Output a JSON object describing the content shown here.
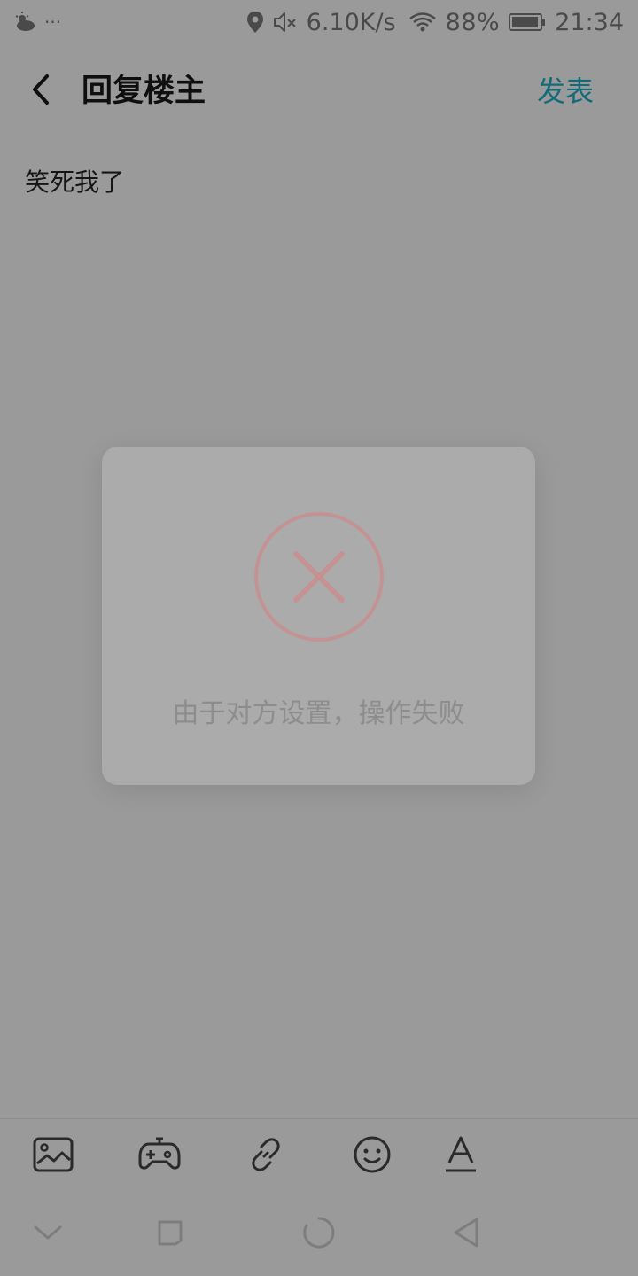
{
  "status_bar": {
    "overflow_dots": "···",
    "network_speed": "6.10K/s",
    "battery_percent": "88%",
    "time": "21:34",
    "icons": [
      "weather-icon",
      "location-icon",
      "mute-icon",
      "wifi-icon",
      "battery-icon"
    ]
  },
  "header": {
    "back_icon": "chevron-left-icon",
    "title": "回复楼主",
    "publish_label": "发表"
  },
  "editor": {
    "content": "笑死我了"
  },
  "toast": {
    "icon": "error-x-icon",
    "message": "由于对方设置，操作失败"
  },
  "toolbar": {
    "items": [
      "image-icon",
      "gamepad-icon",
      "link-icon",
      "emoji-icon",
      "text-format-icon"
    ]
  },
  "nav_bar": {
    "items": [
      "collapse-icon",
      "recent-apps-icon",
      "home-icon",
      "back-triangle-icon"
    ]
  },
  "colors": {
    "accent": "#136b78",
    "error": "#c49292",
    "overlay_background": "#9a9a9a",
    "toast_background": "#ababab"
  }
}
